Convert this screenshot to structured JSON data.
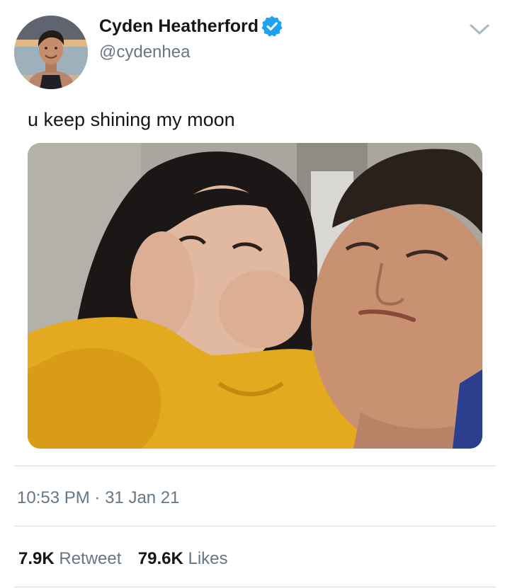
{
  "author": {
    "display_name": "Cyden Heatherford",
    "handle": "@cydenhea",
    "verified": true,
    "verified_color": "#1da1f2",
    "avatar_icon": "profile-photo"
  },
  "header": {
    "menu_icon": "chevron-down-icon"
  },
  "tweet": {
    "text": "u keep shining my moon",
    "media_description": "photo",
    "time": "10:53 PM",
    "separator": "·",
    "date": "31 Jan 21"
  },
  "stats": {
    "retweets_count": "7.9K",
    "retweets_label": "Retweet",
    "likes_count": "79.6K",
    "likes_label": "Likes"
  },
  "colors": {
    "primary_text": "#14171a",
    "secondary_text": "#657786",
    "divider": "#d4dbe1",
    "accent": "#1da1f2"
  }
}
